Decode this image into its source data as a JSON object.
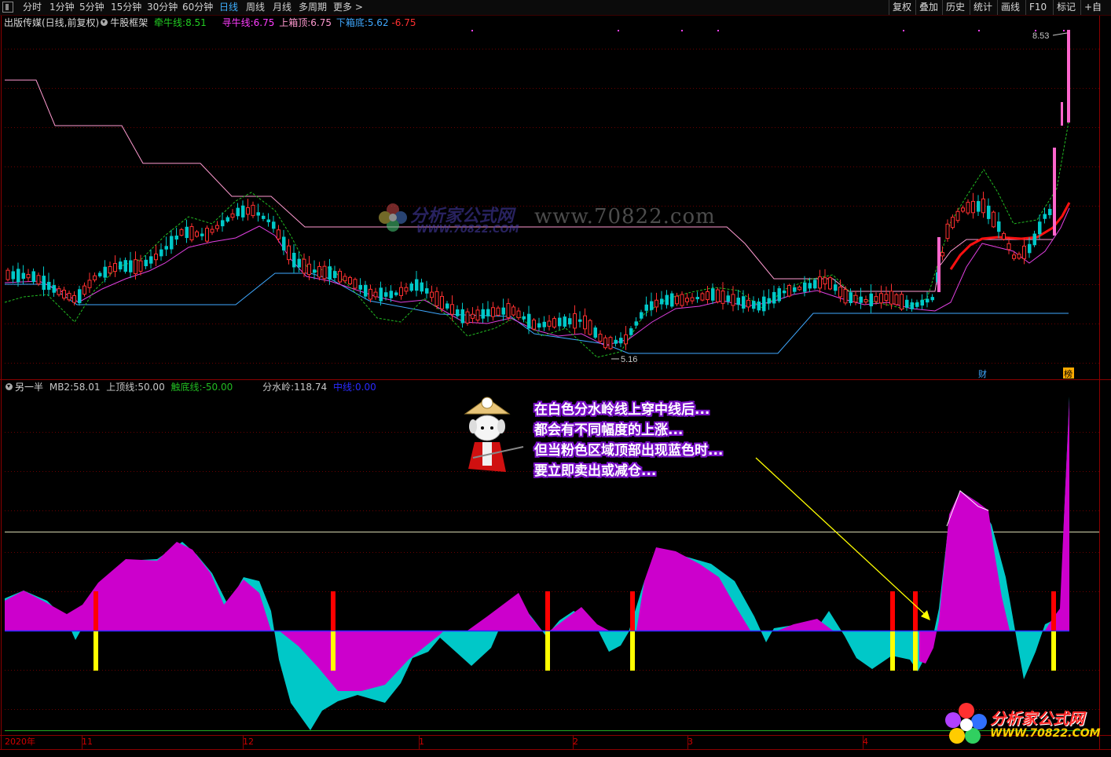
{
  "toolbar": {
    "periods": [
      "分时",
      "1分钟",
      "5分钟",
      "15分钟",
      "30分钟",
      "60分钟",
      "日线",
      "周线",
      "月线",
      "多周期",
      "更多 >"
    ],
    "active_period": "日线",
    "right_buttons": [
      "复权",
      "叠加",
      "历史",
      "统计",
      "画线",
      "F10",
      "标记",
      "+自"
    ]
  },
  "main_legend": {
    "title": "出版传媒(日线,前复权)",
    "indicator": "牛股框架",
    "items": [
      {
        "label": "牵牛线:",
        "value": "8.51",
        "color": "#22cc22"
      },
      {
        "label": "寻牛线:",
        "value": "6.75",
        "color": "#ff3cff"
      },
      {
        "label": "上箱顶:",
        "value": "6.75",
        "color": "#ff9ad0"
      },
      {
        "label": "下箱底:",
        "value": "5.62",
        "color": "#3fa8ff"
      },
      {
        "label": "-",
        "value": "6.75",
        "color": "#ff3030"
      }
    ]
  },
  "main_annotations": {
    "high_price": "8.53",
    "low_price": "5.16",
    "marker_cai": "财",
    "marker_bang": "榜"
  },
  "sub_legend": {
    "title": "另一半",
    "items": [
      {
        "label": "MB2:",
        "value": "58.01",
        "color": "#c8c8c8"
      },
      {
        "label": "上顶线:",
        "value": "50.00",
        "color": "#c8c8c8"
      },
      {
        "label": "触底线:",
        "value": "-50.00",
        "color": "#22bb22"
      },
      {
        "label": "分水岭:",
        "value": "118.74",
        "color": "#c8c8c8"
      },
      {
        "label": "中线:",
        "value": "0.00",
        "color": "#2a2aff"
      }
    ]
  },
  "callout": {
    "lines": [
      "在白色分水岭线上穿中线后...",
      "都会有不同幅度的上涨...",
      "但当粉色区域顶部出现蓝色时...",
      "要立即卖出或减仓..."
    ]
  },
  "x_axis": {
    "labels": [
      "2020年",
      "11",
      "12",
      "1",
      "2",
      "3",
      "4"
    ]
  },
  "watermark": {
    "brand": "分析家公式网",
    "url": "WWW.70822.COM",
    "site": "www.70822.com"
  },
  "logo": {
    "brand": "分析家公式网",
    "url": "WWW.70822.COM"
  },
  "colors": {
    "up_candle": "#ff3030",
    "down_candle": "#00c8c8",
    "pink_area": "#cc00cc",
    "cyan_area": "#00c8c8",
    "signal_red": "#ff0000",
    "signal_yellow": "#ffff00"
  }
}
